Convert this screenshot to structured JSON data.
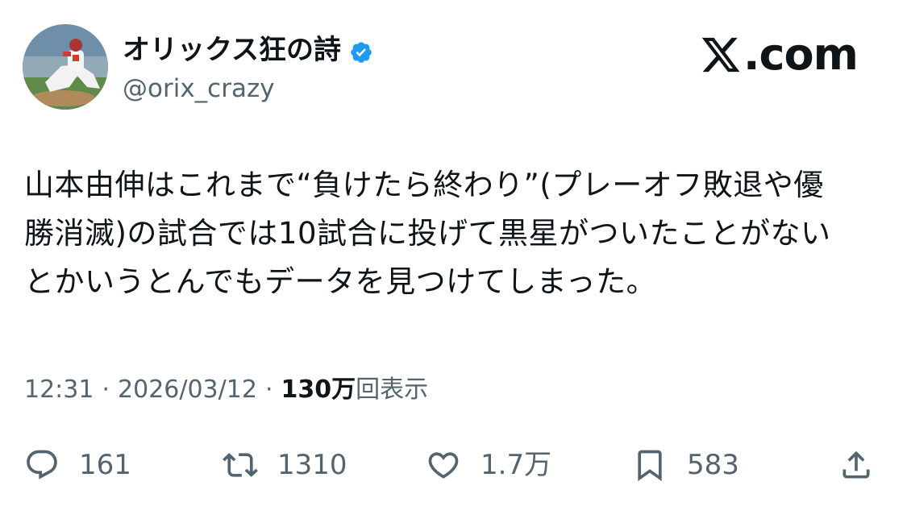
{
  "author": {
    "display_name": "オリックス狂の詩",
    "handle": "@orix_crazy",
    "verified": true
  },
  "brand": {
    "logo_text": ".com",
    "logo_icon": "x-logo-icon"
  },
  "tweet": {
    "lines": [
      "山本由伸はこれまで“負けたら終わり”(プレーオフ敗退や優",
      "勝消滅)の試合では10試合に投げて黒星がついたことがない",
      "とかいうとんでもデータを見つけてしまった。"
    ]
  },
  "meta": {
    "time": "12:31",
    "separator": "·",
    "date": "2026/03/12",
    "views_count": "130万",
    "views_label": "回表示"
  },
  "actions": {
    "replies": {
      "icon": "reply-icon",
      "count": "161"
    },
    "reposts": {
      "icon": "repost-icon",
      "count": "1310"
    },
    "likes": {
      "icon": "heart-icon",
      "count": "1.7万"
    },
    "bookmarks": {
      "icon": "bookmark-icon",
      "count": "583"
    },
    "share": {
      "icon": "share-icon"
    }
  },
  "colors": {
    "text_primary": "#0f1419",
    "text_secondary": "#536471",
    "verified_badge": "#1d9bf0",
    "background": "#ffffff"
  }
}
